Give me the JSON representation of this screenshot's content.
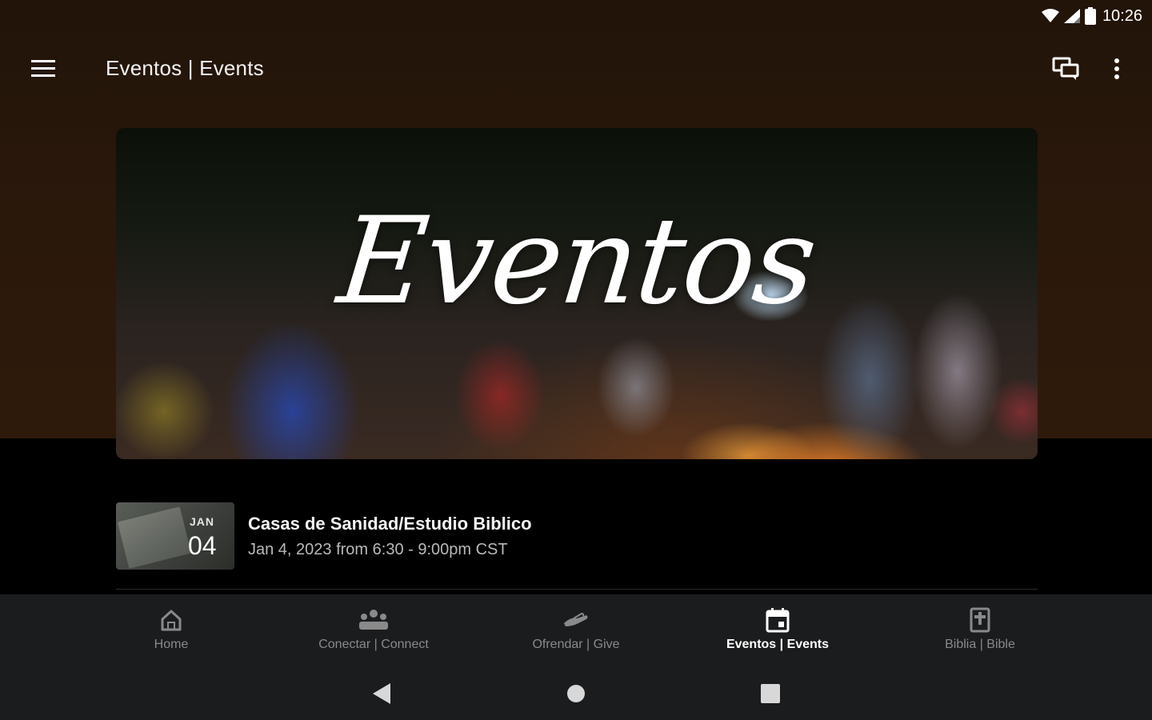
{
  "status_bar": {
    "time": "10:26"
  },
  "app_bar": {
    "title": "Eventos | Events"
  },
  "hero": {
    "script_text": "Eventos"
  },
  "events": [
    {
      "title": "Casas de Sanidad/Estudio Biblico",
      "date_text": "Jan 4, 2023 from 6:30 - 9:00pm CST",
      "thumb_month": "JAN",
      "thumb_day": "04"
    }
  ],
  "bottom_nav": {
    "items": [
      {
        "label": "Home",
        "icon": "home-icon",
        "active": false
      },
      {
        "label": "Conectar | Connect",
        "icon": "people-icon",
        "active": false
      },
      {
        "label": "Ofrendar | Give",
        "icon": "give-hand-icon",
        "active": false
      },
      {
        "label": "Eventos | Events",
        "icon": "calendar-icon",
        "active": true
      },
      {
        "label": "Biblia | Bible",
        "icon": "bible-icon",
        "active": false
      }
    ]
  },
  "colors": {
    "top_background": "#2a180b",
    "nav_background": "#1b1c1e",
    "nav_inactive": "#8a8a8a",
    "nav_active": "#ffffff"
  }
}
